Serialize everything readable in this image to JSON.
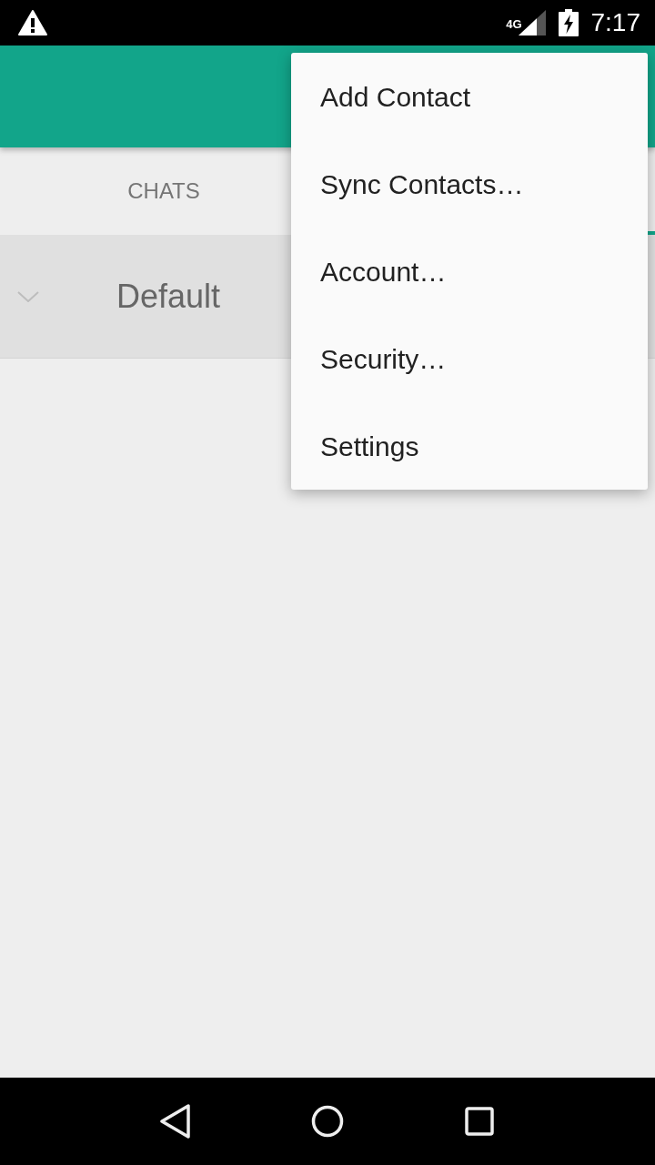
{
  "status_bar": {
    "network_type": "4G",
    "time": "7:17"
  },
  "tabs": [
    {
      "label": "CHATS",
      "selected": false
    },
    {
      "selected": true
    }
  ],
  "groups": [
    {
      "label": "Default"
    }
  ],
  "overflow_menu": {
    "items": [
      {
        "label": "Add Contact"
      },
      {
        "label": "Sync Contacts…"
      },
      {
        "label": "Account…"
      },
      {
        "label": "Security…"
      },
      {
        "label": "Settings"
      }
    ]
  }
}
